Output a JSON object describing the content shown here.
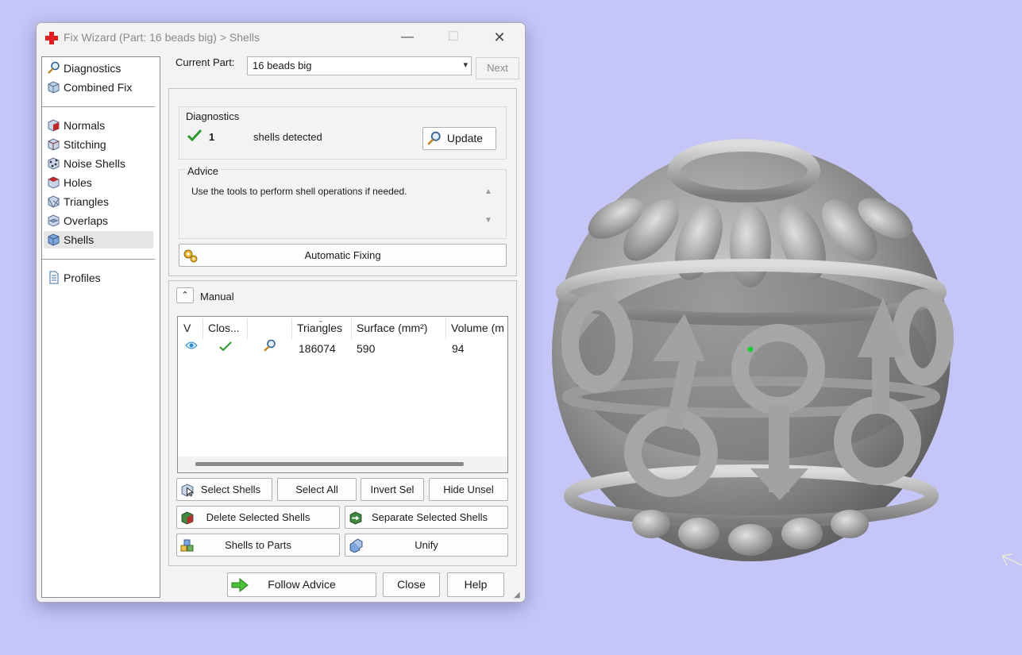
{
  "window": {
    "title": "Fix Wizard (Part: 16 beads big) > Shells",
    "controls": {
      "minimize": "—",
      "maximize": "☐",
      "close": "✕"
    }
  },
  "sidebar": {
    "items": [
      {
        "label": "Diagnostics",
        "icon": "magnifier-icon"
      },
      {
        "label": "Combined Fix",
        "icon": "cube-icon"
      },
      {
        "label": "Normals",
        "icon": "normals-cube-icon"
      },
      {
        "label": "Stitching",
        "icon": "stitching-cube-icon"
      },
      {
        "label": "Noise Shells",
        "icon": "noise-cube-icon"
      },
      {
        "label": "Holes",
        "icon": "holes-cube-icon"
      },
      {
        "label": "Triangles",
        "icon": "triangles-cube-icon"
      },
      {
        "label": "Overlaps",
        "icon": "overlaps-cube-icon"
      },
      {
        "label": "Shells",
        "icon": "shells-cube-icon",
        "selected": true
      },
      {
        "label": "Profiles",
        "icon": "document-icon"
      }
    ]
  },
  "header": {
    "current_part_label": "Current Part:",
    "current_part_value": "16 beads big",
    "next_label": "Next"
  },
  "diagnostics": {
    "title": "Diagnostics",
    "count": "1",
    "status_text": "shells detected",
    "update_label": "Update"
  },
  "advice": {
    "title": "Advice",
    "text": "Use the tools to perform shell operations if needed.",
    "automatic_fixing_label": "Automatic Fixing"
  },
  "manual": {
    "title": "Manual",
    "table": {
      "columns": [
        "V",
        "Clos...",
        "",
        "Triangles",
        "Surface (mm²)",
        "Volume (m"
      ],
      "rows": [
        {
          "triangles": "186074",
          "surface": "590",
          "volume": "94"
        }
      ]
    },
    "buttons": {
      "select_shells": "Select Shells",
      "select_all": "Select All",
      "invert_sel": "Invert Sel",
      "hide_unsel": "Hide Unsel",
      "delete_selected": "Delete Selected Shells",
      "separate_selected": "Separate Selected Shells",
      "shells_to_parts": "Shells to Parts",
      "unify": "Unify"
    }
  },
  "footer": {
    "follow_advice": "Follow Advice",
    "close": "Close",
    "help": "Help"
  },
  "colors": {
    "viewport_bg": "#c5c5f8",
    "window_bg": "#f3f3f3",
    "model_gray": "#8c8c8c",
    "check_green": "#2e9a2e"
  }
}
